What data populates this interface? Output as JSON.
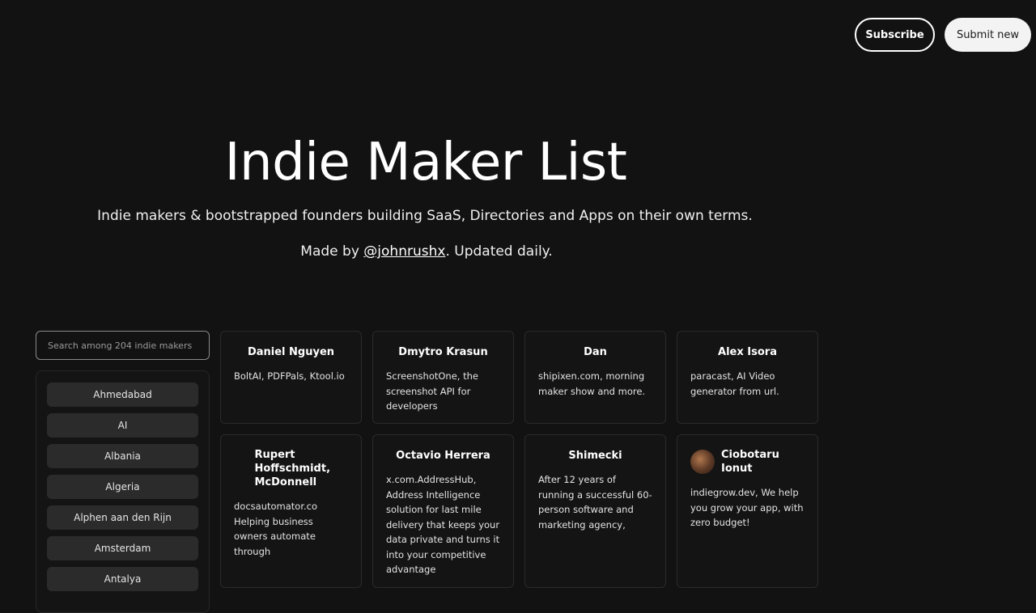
{
  "header": {
    "subscribe_label": "Subscribe",
    "submit_label": "Submit new"
  },
  "hero": {
    "title": "Indie Maker List",
    "subtitle": "Indie makers & bootstrapped founders building SaaS, Directories and Apps on their own terms.",
    "made_by_prefix": "Made by ",
    "made_by_link": "@johnrushx",
    "made_by_suffix": ". Updated daily."
  },
  "search": {
    "placeholder": "Search among 204 indie makers"
  },
  "sidebar": {
    "items": [
      {
        "label": "Ahmedabad"
      },
      {
        "label": "AI"
      },
      {
        "label": "Albania"
      },
      {
        "label": "Algeria"
      },
      {
        "label": "Alphen aan den Rijn"
      },
      {
        "label": "Amsterdam"
      },
      {
        "label": "Antalya"
      }
    ]
  },
  "makers": [
    {
      "name": "Daniel Nguyen",
      "desc": "BoltAI, PDFPals, Ktool.io"
    },
    {
      "name": "Dmytro Krasun",
      "desc": "ScreenshotOne, the screenshot API for developers"
    },
    {
      "name": "Dan",
      "desc": "shipixen.com, morning maker show and more."
    },
    {
      "name": "Alex Isora",
      "desc": "paracast, AI Video generator from url."
    },
    {
      "name": "Rupert Hoffschmidt, McDonnell",
      "desc": "docsautomator.co Helping business owners automate through"
    },
    {
      "name": "Octavio Herrera",
      "desc": "x.com.AddressHub, Address Intelligence solution for last mile delivery that keeps your data private and turns it into your competitive advantage"
    },
    {
      "name": "Shimecki",
      "desc": "After 12 years of running a successful 60-person software and marketing agency,"
    },
    {
      "name": "Ciobotaru Ionut",
      "desc": "indiegrow.dev, We help you grow your app, with zero budget!"
    }
  ]
}
